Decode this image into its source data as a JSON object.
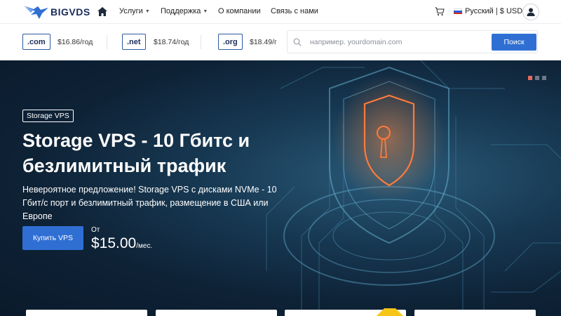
{
  "header": {
    "logo_text": "BIGVDS",
    "nav": [
      {
        "label": "Услуги",
        "dropdown": true
      },
      {
        "label": "Поддержка",
        "dropdown": true
      },
      {
        "label": "О компании",
        "dropdown": false
      },
      {
        "label": "Связь с нами",
        "dropdown": false
      }
    ],
    "language_currency": "Русский | $ USD"
  },
  "domains": {
    "tlds": [
      {
        "name": ".com",
        "price": "$16.86/год"
      },
      {
        "name": ".net",
        "price": "$18.74/год"
      },
      {
        "name": ".org",
        "price": "$18.49/г"
      }
    ],
    "search": {
      "placeholder": "например. yourdomain.com",
      "button_label": "Поиск"
    }
  },
  "hero": {
    "badge": "Storage VPS",
    "title": "Storage VPS - 10 Гбитс и безлимитный трафик",
    "description": "Невероятное предложение! Storage VPS с дисками NVMe - 10 Гбит/с порт и безлимитный трафик, размещение в США или Европе",
    "buy_label": "Купить VPS",
    "price_from": "От",
    "price": "$15.00",
    "price_period": "/мес.",
    "slides_total": 3,
    "active_slide": 1
  },
  "colors": {
    "accent": "#2f6fd4",
    "brand_dark": "#1a2c5b",
    "active_dot": "#e66b5e",
    "shield_glow": "#ff7a3c"
  },
  "icons": [
    "logo-eagle-icon",
    "home-icon",
    "cart-icon",
    "flag-ru-icon",
    "user-icon",
    "search-icon",
    "shield-lock-icon"
  ]
}
